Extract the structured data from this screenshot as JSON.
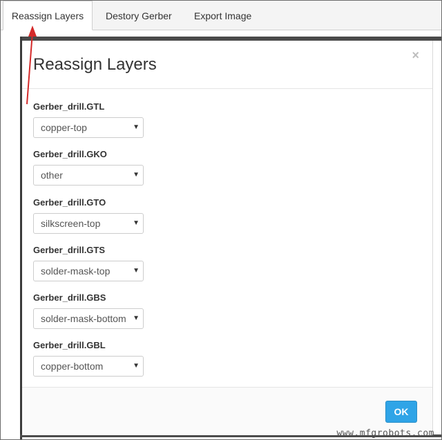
{
  "tabs": [
    {
      "label": "Reassign Layers",
      "active": true
    },
    {
      "label": "Destory Gerber",
      "active": false
    },
    {
      "label": "Export Image",
      "active": false
    }
  ],
  "modal": {
    "title": "Reassign Layers",
    "close_glyph": "×",
    "layers": [
      {
        "file": "Gerber_drill.GTL",
        "selected": "copper-top"
      },
      {
        "file": "Gerber_drill.GKO",
        "selected": "other"
      },
      {
        "file": "Gerber_drill.GTO",
        "selected": "silkscreen-top"
      },
      {
        "file": "Gerber_drill.GTS",
        "selected": "solder-mask-top"
      },
      {
        "file": "Gerber_drill.GBS",
        "selected": "solder-mask-bottom"
      },
      {
        "file": "Gerber_drill.GBL",
        "selected": "copper-bottom"
      }
    ],
    "ok_label": "OK"
  },
  "icons": {
    "close": "close-icon",
    "caret": "caret-down-icon",
    "arrow": "red-arrow-annotation-icon"
  },
  "colors": {
    "accent": "#2fa4e7",
    "annotation": "#d42a2a"
  },
  "watermark": "www.mfgrobots.com"
}
